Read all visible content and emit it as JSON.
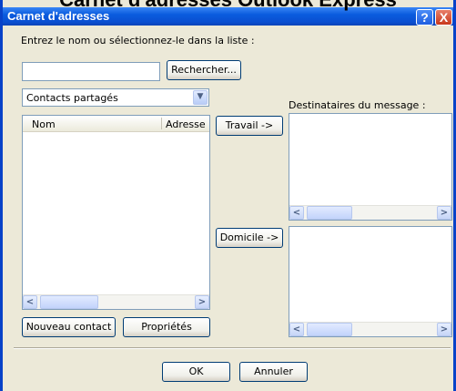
{
  "header_caption": "Carnet d'adresses Outlook Express",
  "window": {
    "title": "Carnet d'adresses",
    "help_icon": "?",
    "close_icon": "X"
  },
  "search": {
    "label": "Entrez le nom ou sélectionnez-le dans la liste :",
    "input_value": "",
    "button_label": "Rechercher..."
  },
  "source_select": {
    "selected": "Contacts partagés",
    "arrow": "chevron-down-icon"
  },
  "contacts_list": {
    "columns": [
      "Nom",
      "Adresse"
    ]
  },
  "move_buttons": {
    "work": "Travail ->",
    "home": "Domicile ->"
  },
  "recipients": {
    "label": "Destinataires du message :"
  },
  "bottom_buttons": {
    "new_contact": "Nouveau contact",
    "properties": "Propriétés"
  },
  "dialog_buttons": {
    "ok": "OK",
    "cancel": "Annuler"
  },
  "scroll_glyphs": {
    "left": "<",
    "right": ">"
  }
}
